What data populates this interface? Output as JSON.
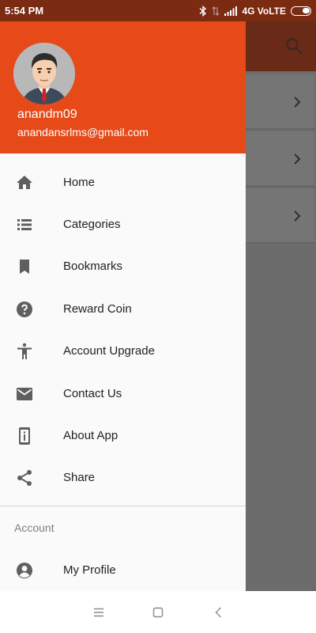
{
  "status_bar": {
    "time": "5:54 PM",
    "network": "4G VoLTE"
  },
  "background_app": {
    "search_icon": "search-icon",
    "rows": 3
  },
  "drawer": {
    "header": {
      "username": "anandm09",
      "email": "anandansrlms@gmail.com",
      "color": "#e64a19"
    },
    "items": [
      {
        "label": "Home",
        "icon": "home-icon"
      },
      {
        "label": "Categories",
        "icon": "list-icon"
      },
      {
        "label": "Bookmarks",
        "icon": "bookmark-icon"
      },
      {
        "label": "Reward Coin",
        "icon": "help-icon"
      },
      {
        "label": "Account Upgrade",
        "icon": "accessibility-icon"
      },
      {
        "label": "Contact Us",
        "icon": "mail-icon"
      },
      {
        "label": "About App",
        "icon": "phone-info-icon"
      },
      {
        "label": "Share",
        "icon": "share-icon"
      }
    ],
    "section": {
      "label": "Account",
      "items": [
        {
          "label": "My Profile",
          "icon": "account-circle-icon"
        }
      ]
    }
  },
  "nav_bar": {
    "buttons": [
      "menu-icon",
      "home-square-icon",
      "back-icon"
    ]
  }
}
